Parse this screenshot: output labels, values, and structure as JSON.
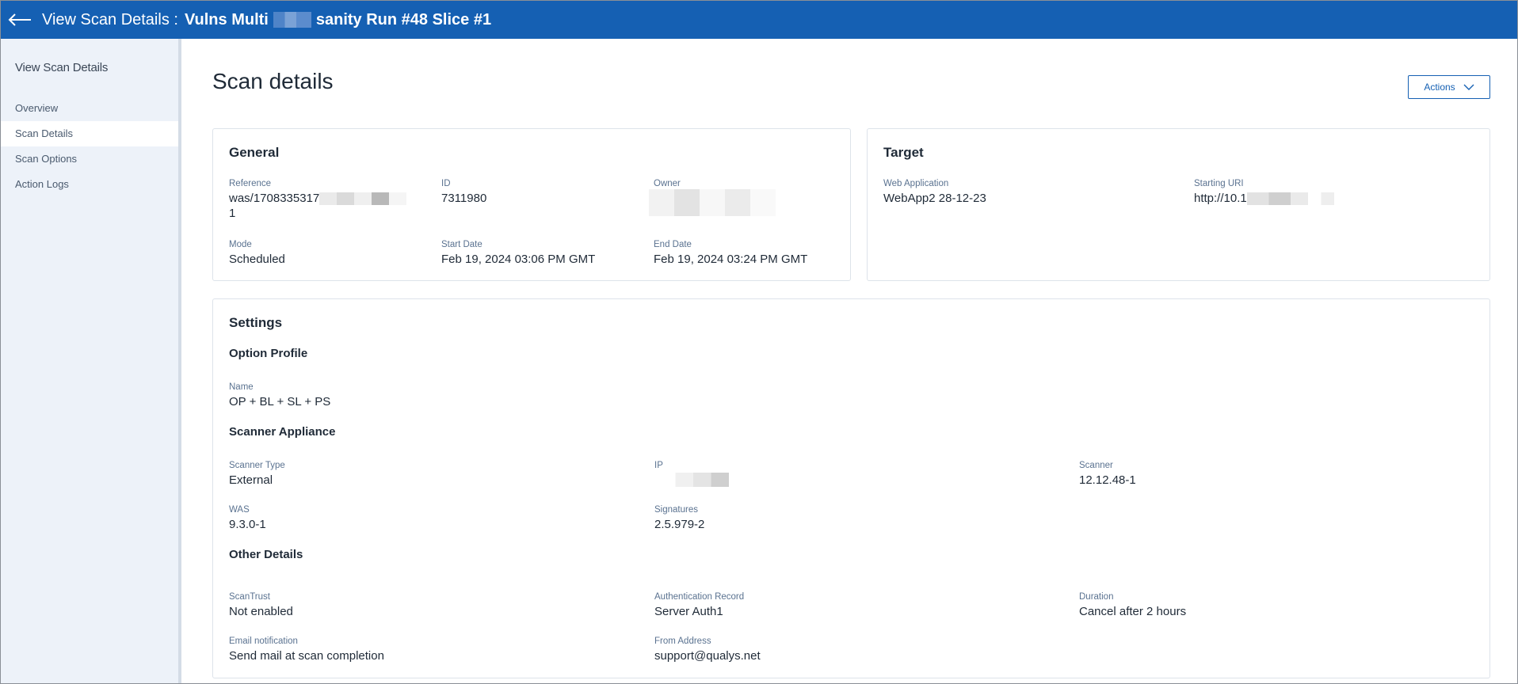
{
  "header": {
    "title_prefix": "View Scan Details :",
    "title_name_part1": "Vulns Multi",
    "title_name_part2": "sanity Run #48 Slice #1"
  },
  "sidebar": {
    "title": "View Scan Details",
    "items": [
      {
        "label": "Overview",
        "active": false
      },
      {
        "label": "Scan Details",
        "active": true
      },
      {
        "label": "Scan Options",
        "active": false
      },
      {
        "label": "Action Logs",
        "active": false
      }
    ]
  },
  "main": {
    "page_title": "Scan details",
    "actions_label": "Actions",
    "general": {
      "title": "General",
      "reference_label": "Reference",
      "reference_value": "was/1708335317",
      "reference_value_line2": "1",
      "id_label": "ID",
      "id_value": "7311980",
      "owner_label": "Owner",
      "mode_label": "Mode",
      "mode_value": "Scheduled",
      "start_label": "Start Date",
      "start_value": "Feb 19, 2024 03:06 PM GMT",
      "end_label": "End Date",
      "end_value": "Feb 19, 2024 03:24 PM GMT"
    },
    "target": {
      "title": "Target",
      "webapp_label": "Web Application",
      "webapp_value": "WebApp2 28-12-23",
      "uri_label": "Starting URI",
      "uri_value": "http://10.1"
    },
    "settings": {
      "title": "Settings",
      "option_profile_title": "Option Profile",
      "name_label": "Name",
      "name_value": "OP + BL + SL + PS",
      "scanner_appliance_title": "Scanner Appliance",
      "scanner_type_label": "Scanner Type",
      "scanner_type_value": "External",
      "ip_label": "IP",
      "scanner_label": "Scanner",
      "scanner_value": "12.12.48-1",
      "was_label": "WAS",
      "was_value": "9.3.0-1",
      "signatures_label": "Signatures",
      "signatures_value": "2.5.979-2",
      "other_details_title": "Other Details",
      "scantrust_label": "ScanTrust",
      "scantrust_value": "Not enabled",
      "auth_label": "Authentication Record",
      "auth_value": "Server Auth1",
      "duration_label": "Duration",
      "duration_value": "Cancel after 2 hours",
      "email_label": "Email notification",
      "email_value": "Send mail at scan completion",
      "from_label": "From Address",
      "from_value": "support@qualys.net"
    }
  },
  "colors": {
    "header_bg": "#1560b3",
    "sidebar_bg": "#edf2f9",
    "label": "#5a7290"
  },
  "icons": {
    "back": "arrow-left-icon",
    "actions": "chevron-down-icon"
  }
}
